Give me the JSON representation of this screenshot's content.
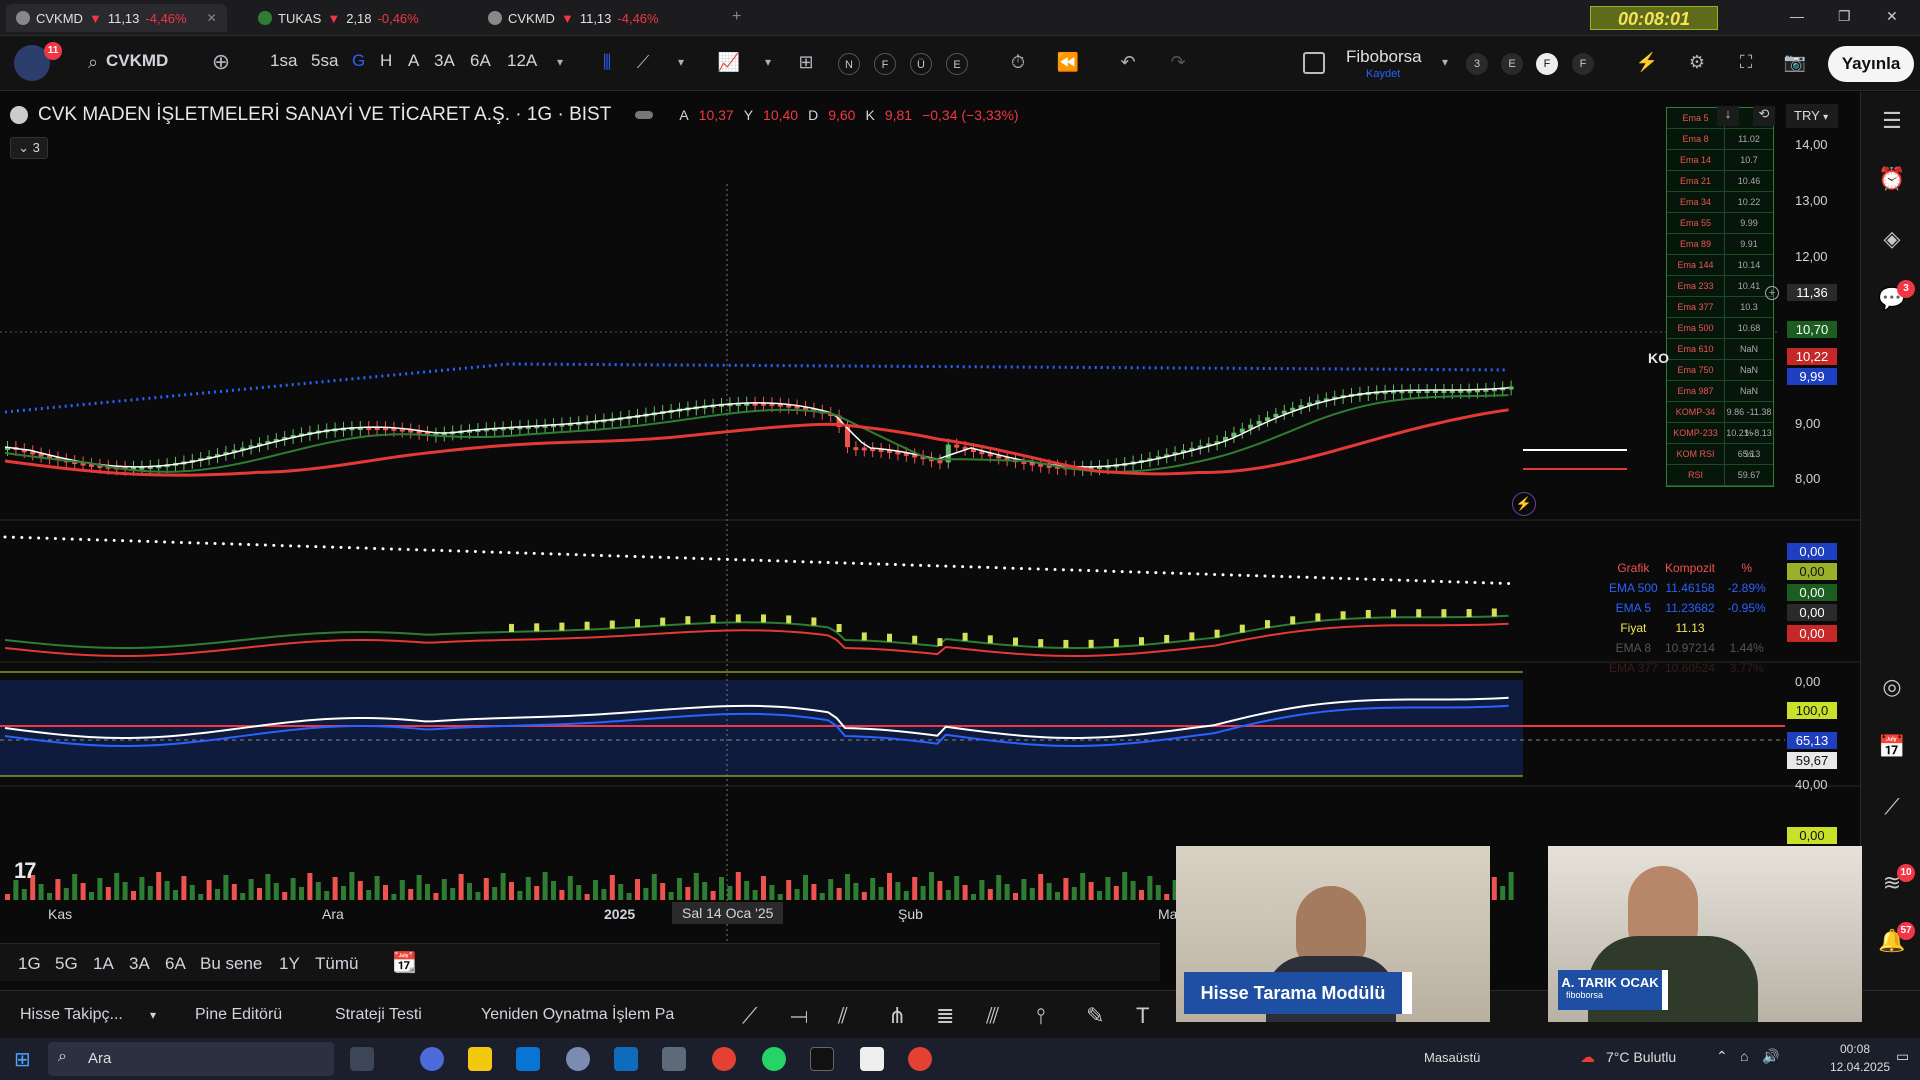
{
  "tabs": [
    {
      "symbol": "CVKMD",
      "arrow": "▼",
      "price": "11,13",
      "change": "-4,46%"
    },
    {
      "symbol": "TUKAS",
      "arrow": "▼",
      "price": "2,18",
      "change": "-0,46%"
    },
    {
      "symbol": "CVKMD",
      "arrow": "▼",
      "price": "11,13",
      "change": "-4,46%"
    }
  ],
  "timer": "00:08:01",
  "toolbar": {
    "profile_badge": "11",
    "symbol": "CVKMD",
    "intervals": [
      "1sa",
      "5sa",
      "G",
      "H",
      "A",
      "3A",
      "6A",
      "12A"
    ],
    "letter_buttons": [
      "N",
      "F",
      "Ü",
      "E"
    ],
    "layout_name": "Fiboborsa",
    "layout_sub": "Kaydet",
    "circle_buttons": [
      "3",
      "E",
      "F",
      "F"
    ],
    "publish": "Yayınla"
  },
  "chart_header": {
    "title": "CVK MADEN İŞLETMELERİ SANAYİ VE TİCARET A.Ş. · 1G · BIST",
    "ohlc_labels": [
      "A",
      "Y",
      "D",
      "K"
    ],
    "ohlc_values": [
      "10,37",
      "10,40",
      "9,60",
      "9,81"
    ],
    "change_text": "−0,34 (−3,33%)",
    "collapse": "3",
    "currency": "TRY"
  },
  "price_axis": [
    "14,00",
    "13,00",
    "12,00",
    "9,00",
    "8,00"
  ],
  "price_tags": [
    {
      "value": "11,36",
      "bg": "#2a2a2a"
    },
    {
      "value": "10,70",
      "bg": "#1b5e20"
    },
    {
      "value": "10,22",
      "bg": "#c62828"
    },
    {
      "value": "9,99",
      "bg": "#1e3fbf"
    }
  ],
  "ema_table": [
    {
      "name": "Ema 5",
      "value": ""
    },
    {
      "name": "Ema 8",
      "value": "11.02"
    },
    {
      "name": "Ema 14",
      "value": "10.7"
    },
    {
      "name": "Ema 21",
      "value": "10.46"
    },
    {
      "name": "Ema 34",
      "value": "10.22"
    },
    {
      "name": "Ema 55",
      "value": "9.99"
    },
    {
      "name": "Ema 89",
      "value": "9.91"
    },
    {
      "name": "Ema 144",
      "value": "10.14"
    },
    {
      "name": "Ema 233",
      "value": "10.41"
    },
    {
      "name": "Ema 377",
      "value": "10.3"
    },
    {
      "name": "Ema 500",
      "value": "10.68"
    },
    {
      "name": "Ema 610",
      "value": "NaN"
    },
    {
      "name": "Ema 750",
      "value": "NaN"
    },
    {
      "name": "Ema 987",
      "value": "NaN"
    },
    {
      "name": "KOMP-34",
      "value": "9.86 -11.38 %"
    },
    {
      "name": "KOMP-233",
      "value": "10.21 -8.13 %"
    },
    {
      "name": "KOM RSI",
      "value": "65.13"
    },
    {
      "name": "RSI",
      "value": "59.67"
    }
  ],
  "komposit": {
    "headers": [
      "Grafik",
      "Kompozit",
      "%"
    ],
    "rows": [
      {
        "label": "EMA 500",
        "value": "11.46158",
        "pct": "-2.89%",
        "color": "#2962ff"
      },
      {
        "label": "EMA 5",
        "value": "11.23682",
        "pct": "-0.95%",
        "color": "#2962ff"
      },
      {
        "label": "Fiyat",
        "value": "11.13",
        "pct": "",
        "color": "#f6e35a"
      },
      {
        "label": "EMA 8",
        "value": "10.97214",
        "pct": "1.44%",
        "color": "#555"
      },
      {
        "label": "EMA 377",
        "value": "10.60524",
        "pct": "3.77%",
        "color": "#3a1a1a"
      }
    ]
  },
  "mid_axis": {
    "tags": [
      {
        "value": "0,00",
        "bg": "#1e3fbf",
        "color": "#fff"
      },
      {
        "value": "0,00",
        "bg": "#9bb02a",
        "color": "#111"
      },
      {
        "value": "0,00",
        "bg": "#1b5e20",
        "color": "#fff"
      },
      {
        "value": "0,00",
        "bg": "#2a2a2a",
        "color": "#fff"
      },
      {
        "value": "0,00",
        "bg": "#c62828",
        "color": "#fff"
      }
    ],
    "bottom": "0,00"
  },
  "rsi_axis": {
    "top": "100,0",
    "kom_rsi": "65,13",
    "rsi": "59,67",
    "level": "40,00",
    "bottom": "0,00"
  },
  "x_axis": [
    "Kas",
    "Ara",
    "2025",
    "Sal 14 Oca '25",
    "Şub",
    "Ma"
  ],
  "right_sidebar_badges": {
    "chat": "3",
    "feed": "10",
    "notif": "57"
  },
  "ema_label": "KO",
  "timerange": [
    "1G",
    "5G",
    "1A",
    "3A",
    "6A",
    "Bu sene",
    "1Y",
    "Tümü"
  ],
  "bottom_tabs": [
    "Hisse Takipç...",
    "Pine Editörü",
    "Strateji Testi",
    "Yeniden Oynatma İşlem Pa"
  ],
  "cams": {
    "left_label": "Hisse Tarama Modülü",
    "right_name": "A. TARIK OCAK",
    "right_sub": "fiboborsa"
  },
  "taskbar": {
    "search": "Ara",
    "desktop": "Masaüstü",
    "weather": "7°C Bulutlu",
    "time": "00:08",
    "date": "12.04.2025"
  },
  "tradingview_logo": "17"
}
